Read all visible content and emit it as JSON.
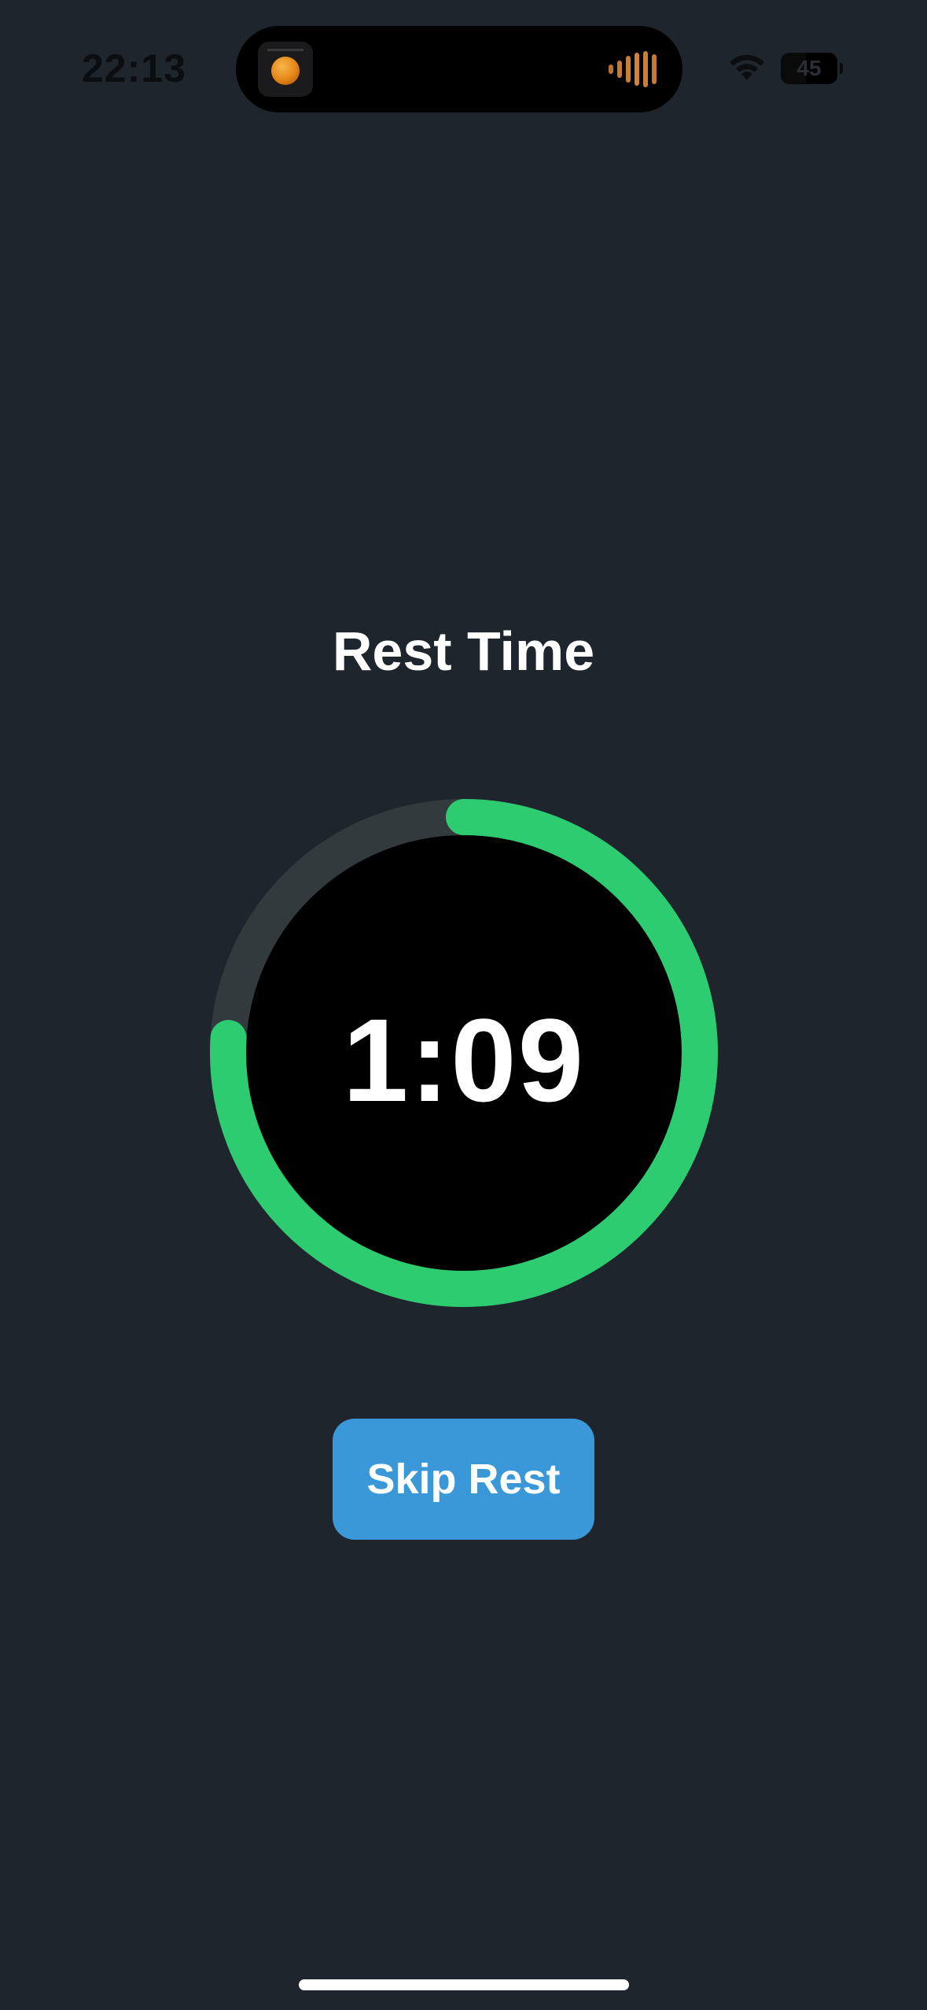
{
  "status_bar": {
    "time": "22:13",
    "battery_level": "45",
    "icons": {
      "wifi": "wifi-icon",
      "battery": "battery-icon",
      "now_playing_art": "album-art-icon",
      "audio_wave": "audio-wave-icon"
    }
  },
  "rest_timer": {
    "title": "Rest Time",
    "time_remaining": "1:09",
    "progress_fraction": 0.76,
    "colors": {
      "progress": "#2ecc71",
      "track": "#323a3e",
      "face": "#000000",
      "button": "#3a98d8",
      "background": "#1f252d"
    }
  },
  "actions": {
    "skip_label": "Skip Rest"
  }
}
